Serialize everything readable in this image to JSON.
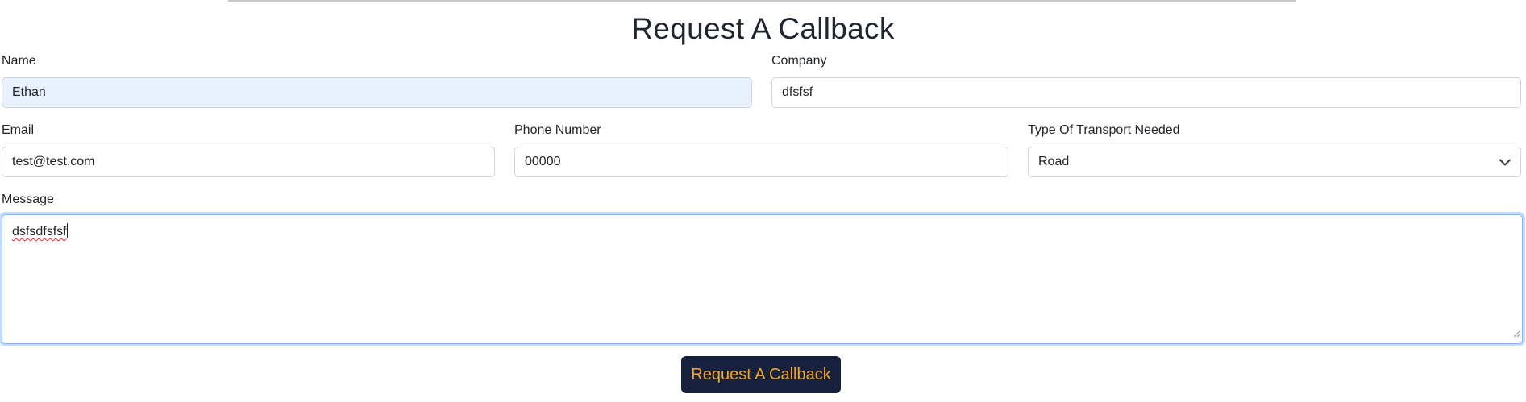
{
  "title": "Request A Callback",
  "fields": {
    "name": {
      "label": "Name",
      "value": "Ethan"
    },
    "company": {
      "label": "Company",
      "value": "dfsfsf"
    },
    "email": {
      "label": "Email",
      "value": "test@test.com"
    },
    "phone": {
      "label": "Phone Number",
      "value": "00000"
    },
    "transport": {
      "label": "Type Of Transport Needed",
      "value": "Road"
    },
    "message": {
      "label": "Message",
      "value": "dsfsdfsfsf"
    }
  },
  "submit_label": "Request A Callback",
  "colors": {
    "button_bg": "#16213e",
    "button_text": "#f5a623",
    "autofill_bg": "#e8f0fe",
    "focus_border": "#86b7fe"
  },
  "icons": {
    "select_arrow": "chevron-down-icon",
    "resize_grip": "resize-grip-icon"
  }
}
